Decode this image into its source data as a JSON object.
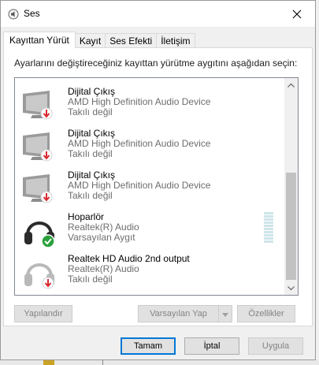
{
  "window": {
    "title": "Ses",
    "icon": "speaker-app-icon",
    "close_icon": "close-icon"
  },
  "tabs": [
    {
      "label": "Kayıttan Yürüt",
      "active": true
    },
    {
      "label": "Kayıt",
      "active": false
    },
    {
      "label": "Ses Efekti",
      "active": false
    },
    {
      "label": "İletişim",
      "active": false
    }
  ],
  "instruction": "Ayarlarını değiştireceğiniz kayıttan yürütme aygıtını aşağıdan seçin:",
  "devices": [
    {
      "name": "Dijital Çıkış",
      "description": "AMD High Definition Audio Device",
      "status": "Takılı değil",
      "icon": "monitor-icon",
      "badge": "disconnected-arrow-icon"
    },
    {
      "name": "Dijital Çıkış",
      "description": "AMD High Definition Audio Device",
      "status": "Takılı değil",
      "icon": "monitor-icon",
      "badge": "disconnected-arrow-icon"
    },
    {
      "name": "Dijital Çıkış",
      "description": "AMD High Definition Audio Device",
      "status": "Takılı değil",
      "icon": "monitor-icon",
      "badge": "disconnected-arrow-icon"
    },
    {
      "name": "Hoparlör",
      "description": "Realtek(R) Audio",
      "status": "Varsayılan Aygıt",
      "icon": "headphones-icon",
      "badge": "default-check-icon"
    },
    {
      "name": "Realtek HD Audio 2nd output",
      "description": "Realtek(R) Audio",
      "status": "Takılı değil",
      "icon": "headphones-icon",
      "badge": "disconnected-arrow-icon"
    }
  ],
  "buttons": {
    "configure": "Yapılandır",
    "set_default": "Varsayılan Yap",
    "properties": "Özellikler",
    "ok": "Tamam",
    "cancel": "İptal",
    "apply": "Uygula"
  },
  "colors": {
    "accent": "#0078d7",
    "check_green": "#2aa13b",
    "unplugged_red": "#d8292f"
  }
}
